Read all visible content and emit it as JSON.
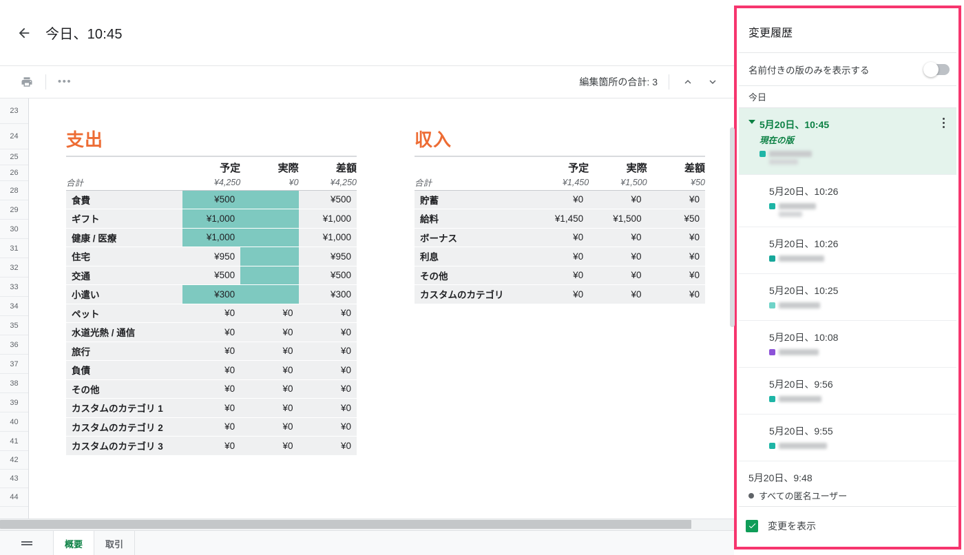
{
  "header": {
    "back_icon": "arrow-left-icon",
    "title": "今日、10:45"
  },
  "toolbar": {
    "print_icon": "print-icon",
    "more_icon": "more-horizontal-icon",
    "edit_count_label": "編集箇所の合計: 3",
    "prev_icon": "chevron-up-icon",
    "next_icon": "chevron-down-icon"
  },
  "spreadsheet": {
    "row_numbers": [
      "23",
      "24",
      "25",
      "26",
      "28",
      "29",
      "30",
      "31",
      "32",
      "33",
      "34",
      "35",
      "36",
      "37",
      "38",
      "39",
      "40",
      "41",
      "42",
      "43",
      "44"
    ],
    "expense": {
      "title": "支出",
      "columns": [
        "",
        "予定",
        "実際",
        "差額"
      ],
      "total_label": "合計",
      "totals": [
        "¥4,250",
        "¥0",
        "¥4,250"
      ],
      "rows": [
        {
          "category": "食費",
          "planned": "¥500",
          "actual": "",
          "diff": "¥500",
          "hl_planned": true,
          "hl_actual": true
        },
        {
          "category": "ギフト",
          "planned": "¥1,000",
          "actual": "",
          "diff": "¥1,000",
          "hl_planned": true,
          "hl_actual": true
        },
        {
          "category": "健康 / 医療",
          "planned": "¥1,000",
          "actual": "",
          "diff": "¥1,000",
          "hl_planned": true,
          "hl_actual": true
        },
        {
          "category": "住宅",
          "planned": "¥950",
          "actual": "",
          "diff": "¥950",
          "hl_planned": false,
          "hl_actual": true
        },
        {
          "category": "交通",
          "planned": "¥500",
          "actual": "",
          "diff": "¥500",
          "hl_planned": false,
          "hl_actual": true
        },
        {
          "category": "小遣い",
          "planned": "¥300",
          "actual": "",
          "diff": "¥300",
          "hl_planned": true,
          "hl_actual": true
        },
        {
          "category": "ペット",
          "planned": "¥0",
          "actual": "¥0",
          "diff": "¥0",
          "hl_planned": false,
          "hl_actual": false
        },
        {
          "category": "水道光熱 / 通信",
          "planned": "¥0",
          "actual": "¥0",
          "diff": "¥0",
          "hl_planned": false,
          "hl_actual": false
        },
        {
          "category": "旅行",
          "planned": "¥0",
          "actual": "¥0",
          "diff": "¥0",
          "hl_planned": false,
          "hl_actual": false
        },
        {
          "category": "負債",
          "planned": "¥0",
          "actual": "¥0",
          "diff": "¥0",
          "hl_planned": false,
          "hl_actual": false
        },
        {
          "category": "その他",
          "planned": "¥0",
          "actual": "¥0",
          "diff": "¥0",
          "hl_planned": false,
          "hl_actual": false
        },
        {
          "category": "カスタムのカテゴリ 1",
          "planned": "¥0",
          "actual": "¥0",
          "diff": "¥0",
          "hl_planned": false,
          "hl_actual": false
        },
        {
          "category": "カスタムのカテゴリ 2",
          "planned": "¥0",
          "actual": "¥0",
          "diff": "¥0",
          "hl_planned": false,
          "hl_actual": false
        },
        {
          "category": "カスタムのカテゴリ 3",
          "planned": "¥0",
          "actual": "¥0",
          "diff": "¥0",
          "hl_planned": false,
          "hl_actual": false
        }
      ]
    },
    "income": {
      "title": "収入",
      "columns": [
        "",
        "予定",
        "実際",
        "差額"
      ],
      "total_label": "合計",
      "totals": [
        "¥1,450",
        "¥1,500",
        "¥50"
      ],
      "rows": [
        {
          "category": "貯蓄",
          "planned": "¥0",
          "actual": "¥0",
          "diff": "¥0"
        },
        {
          "category": "給料",
          "planned": "¥1,450",
          "actual": "¥1,500",
          "diff": "¥50"
        },
        {
          "category": "ボーナス",
          "planned": "¥0",
          "actual": "¥0",
          "diff": "¥0"
        },
        {
          "category": "利息",
          "planned": "¥0",
          "actual": "¥0",
          "diff": "¥0"
        },
        {
          "category": "その他",
          "planned": "¥0",
          "actual": "¥0",
          "diff": "¥0"
        },
        {
          "category": "カスタムのカテゴリ",
          "planned": "¥0",
          "actual": "¥0",
          "diff": "¥0"
        }
      ]
    },
    "highlight_color": "#7ec9c0",
    "title_color": "#ed6c34"
  },
  "sheet_tabs": {
    "menu_icon": "all-sheets-icon",
    "tabs": [
      {
        "label": "概要",
        "active": true
      },
      {
        "label": "取引",
        "active": false
      }
    ]
  },
  "version_history": {
    "panel_title": "変更履歴",
    "toggle_label": "名前付きの版のみを表示する",
    "toggle_on": false,
    "group_label": "今日",
    "highlight_border_color": "#f6356e",
    "items": [
      {
        "time": "5月20日、10:45",
        "subtitle": "現在の版",
        "current": true,
        "caret_icon": "caret-down-icon",
        "kebab_icon": "more-vertical-icon",
        "user_dot_color": "#1eb5a6",
        "name_redacted": true,
        "name_width": 62,
        "name2_width": 42
      },
      {
        "time": "5月20日、10:26",
        "current": false,
        "user_dot_color": "#1eb5a6",
        "name_redacted": true,
        "name_width": 54,
        "name2_width": 34
      },
      {
        "time": "5月20日、10:26",
        "current": false,
        "user_dot_color": "#17a79a",
        "name_redacted": true,
        "name_width": 66,
        "name2_width": 0
      },
      {
        "time": "5月20日、10:25",
        "current": false,
        "user_dot_color": "#6fd3c8",
        "name_redacted": true,
        "name_width": 60,
        "name2_width": 0
      },
      {
        "time": "5月20日、10:08",
        "current": false,
        "user_dot_color": "#8c52d8",
        "name_redacted": true,
        "name_width": 58,
        "name2_width": 0
      },
      {
        "time": "5月20日、9:56",
        "current": false,
        "user_dot_color": "#1eb5a6",
        "name_redacted": true,
        "name_width": 62,
        "name2_width": 0
      },
      {
        "time": "5月20日、9:55",
        "current": false,
        "user_dot_color": "#1eb5a6",
        "name_redacted": true,
        "name_width": 70,
        "name2_width": 0
      },
      {
        "time": "5月20日、9:48",
        "current": false,
        "anonymous_label": "すべての匿名ユーザー",
        "name_redacted": false
      }
    ],
    "footer": {
      "checkbox_checked": true,
      "checkbox_icon": "check-icon",
      "label": "変更を表示"
    }
  }
}
